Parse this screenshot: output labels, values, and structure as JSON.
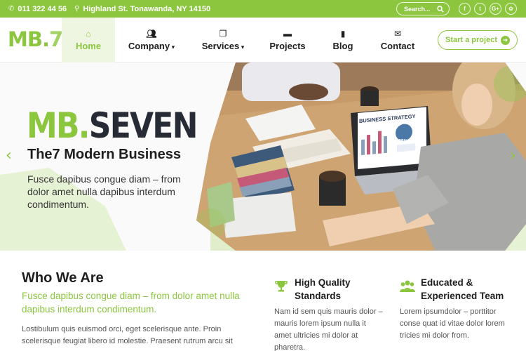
{
  "topbar": {
    "phone": "011 322 44 56",
    "address": "Highland St. Tonawanda, NY 14150",
    "search_placeholder": "Search...",
    "social": [
      "f",
      "t",
      "G+",
      "✿"
    ]
  },
  "header": {
    "logo_main": "MB.",
    "logo_num": "7",
    "nav": [
      {
        "label": "Home",
        "icon": "home-icon"
      },
      {
        "label": "Company",
        "icon": "users-icon"
      },
      {
        "label": "Services",
        "icon": "copy-icon"
      },
      {
        "label": "Projects",
        "icon": "folder-icon"
      },
      {
        "label": "Blog",
        "icon": "bookmark-icon"
      },
      {
        "label": "Contact",
        "icon": "envelope-icon"
      }
    ],
    "cta": "Start a project"
  },
  "hero": {
    "brand_green": "MB.",
    "brand_dark": "SEVEN",
    "subtitle": "The7 Modern Business",
    "text": "Fusce dapibus congue diam – from dolor amet nulla dapibus interdum condimentum.",
    "laptop_caption": "BUSINESS STRATEGY",
    "laptop_value": "85%"
  },
  "who": {
    "title": "Who We Are",
    "subtitle": "Fusce dapibus congue diam – from dolor amet nulla dapibus interdum condimentum.",
    "body": "Lostibulum quis euismod orci, eget scelerisque ante. Proin scelerisque feugiat libero id molestie. Praesent rutrum arcu sit"
  },
  "features": [
    {
      "title": "High Quality Standards",
      "icon": "trophy-icon",
      "body": "Nam id sem quis mauris dolor – mauris lorem ipsum nulla it amet ultricies mi dolor at pharetra."
    },
    {
      "title": "Educated & Experienced Team",
      "icon": "team-icon",
      "body": "Lorem ipsumdolor – porttitor conse quat id vitae dolor lorem tricies mi dolor from."
    }
  ],
  "colors": {
    "accent": "#8cc63f",
    "dark": "#262b35"
  }
}
